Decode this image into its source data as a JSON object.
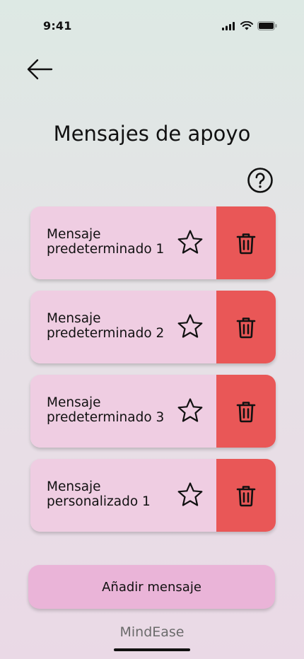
{
  "status": {
    "time": "9:41"
  },
  "header": {
    "title": "Mensajes de apoyo"
  },
  "messages": [
    {
      "line1": "Mensaje",
      "line2": "predeterminado 1"
    },
    {
      "line1": "Mensaje",
      "line2": "predeterminado 2"
    },
    {
      "line1": "Mensaje",
      "line2": "predeterminado 3"
    },
    {
      "line1": "Mensaje",
      "line2": "personalizado 1"
    }
  ],
  "actions": {
    "add_label": "Añadir mensaje"
  },
  "footer": {
    "brand": "MindEase"
  },
  "colors": {
    "card": "#efcde2",
    "delete": "#e95757",
    "add_button": "#eab4d8"
  },
  "icons": {
    "back": "arrow-left-icon",
    "help": "question-circle-icon",
    "favorite": "star-icon",
    "delete": "trash-icon"
  }
}
